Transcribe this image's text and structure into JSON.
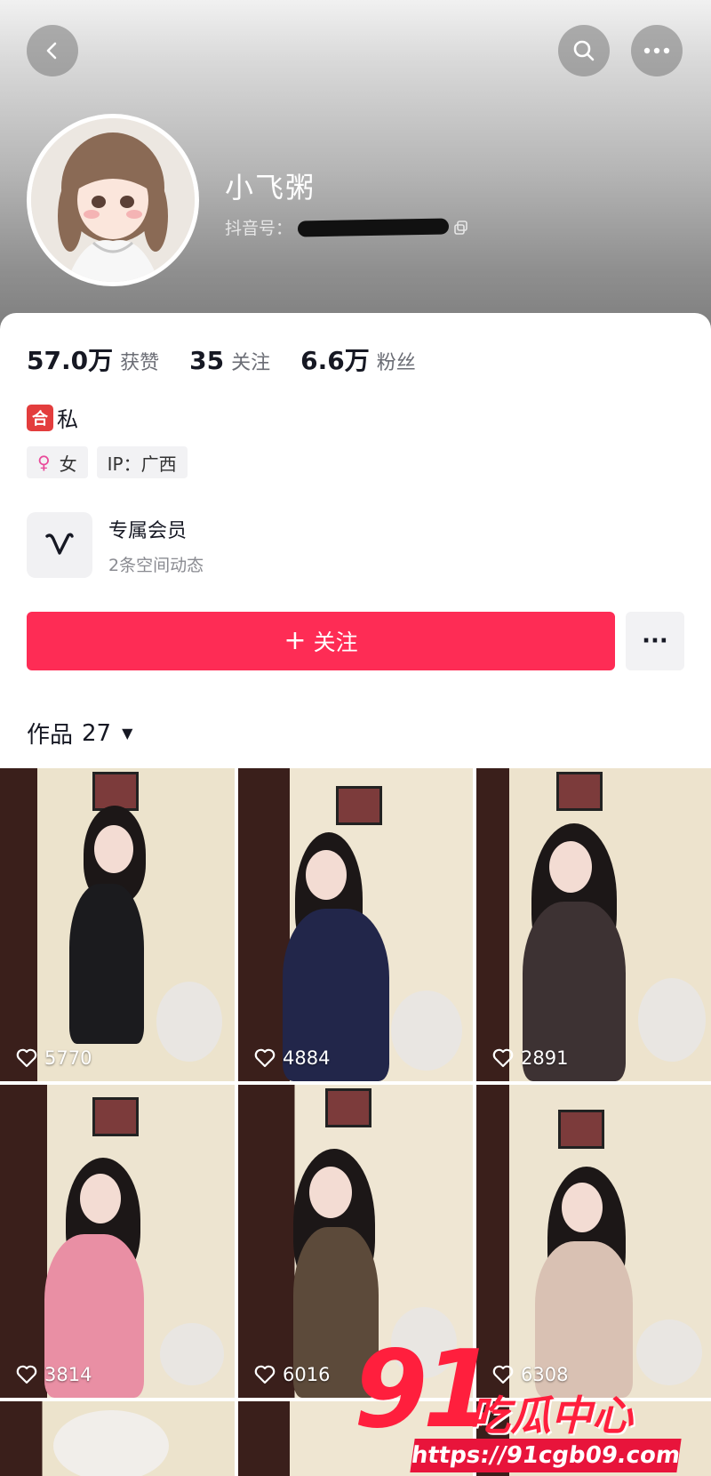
{
  "profile": {
    "nickname": "小飞粥",
    "douyin_id_label": "抖音号：",
    "bio": "私",
    "bio_emoji": "合",
    "gender_tag": "女",
    "ip_tag": "IP：广西"
  },
  "stats": [
    {
      "num": "57.0万",
      "label": "获赞"
    },
    {
      "num": "35",
      "label": "关注"
    },
    {
      "num": "6.6万",
      "label": "粉丝"
    }
  ],
  "member": {
    "title": "专属会员",
    "subtitle": "2条空间动态"
  },
  "actions": {
    "follow_plus": "+",
    "follow_label": "关注",
    "more_label": "···"
  },
  "works": {
    "label": "作品",
    "count": "27"
  },
  "videos": [
    {
      "likes": "5770"
    },
    {
      "likes": "4884"
    },
    {
      "likes": "2891"
    },
    {
      "likes": "3814"
    },
    {
      "likes": "6016"
    },
    {
      "likes": "6308"
    }
  ],
  "watermark": {
    "brand_num": "91",
    "brand_cn": "吃瓜中心",
    "url": "https://91cgb09.com"
  },
  "colors": {
    "accent": "#fe2c55",
    "watermark": "#ff1f3d"
  }
}
